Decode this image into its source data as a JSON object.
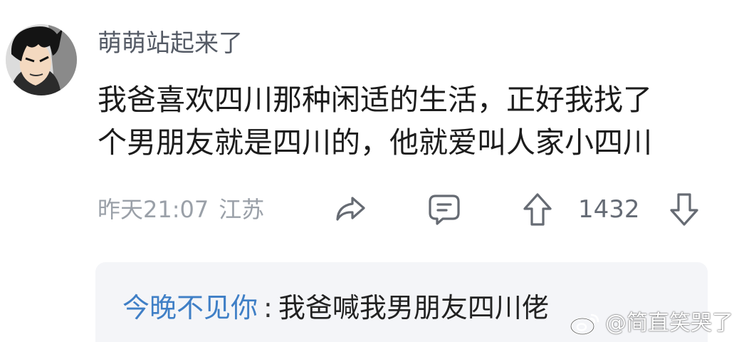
{
  "comment": {
    "username": "萌萌站起来了",
    "body_lines": [
      "我爸喜欢四川那种闲适的生活，正好我找了",
      "个男朋友就是四川的，他就爱叫人家小四川"
    ],
    "time": "昨天21:07",
    "location": "江苏",
    "vote_count": "1432",
    "icons": {
      "avatar": "avatar-anime",
      "share": "share-icon",
      "comment": "comment-icon",
      "upvote": "arrow-up-icon",
      "downvote": "arrow-down-icon"
    }
  },
  "reply": {
    "author": "今晚不见你",
    "separator": ":",
    "text": "我爸喊我男朋友四川佬"
  },
  "watermark": {
    "text": "@简直笑哭了",
    "icon": "weibo-icon"
  }
}
